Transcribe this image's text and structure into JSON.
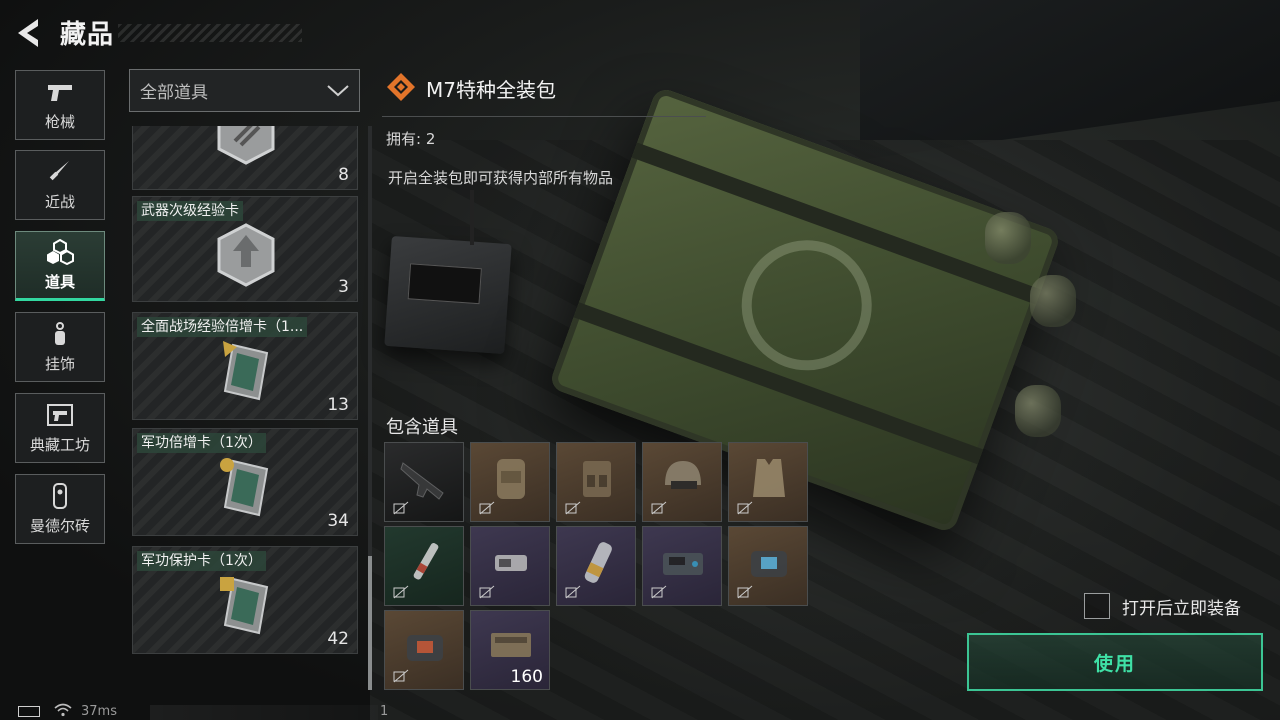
{
  "header": {
    "title": "藏品"
  },
  "categories": [
    {
      "label": "枪械",
      "icon": "pistol-icon"
    },
    {
      "label": "近战",
      "icon": "knife-icon"
    },
    {
      "label": "道具",
      "icon": "cubes-icon",
      "active": true
    },
    {
      "label": "挂饰",
      "icon": "charm-icon"
    },
    {
      "label": "典藏工坊",
      "icon": "workshop-icon"
    },
    {
      "label": "曼德尔砖",
      "icon": "brick-icon"
    }
  ],
  "filter": {
    "selected": "全部道具"
  },
  "items": [
    {
      "name": "",
      "count": "8"
    },
    {
      "name": "武器次级经验卡",
      "count": "3"
    },
    {
      "name": "全面战场经验倍增卡（1...",
      "count": "13"
    },
    {
      "name": "军功倍增卡（1次）",
      "count": "34"
    },
    {
      "name": "军功保护卡（1次）",
      "count": "42"
    }
  ],
  "detail": {
    "name": "M7特种全装包",
    "owned": "拥有: 2",
    "description": "开启全装包即可获得内部所有物品",
    "contains_title": "包含道具",
    "contents": [
      {
        "item": "rifle",
        "rarity": "black"
      },
      {
        "item": "backpack",
        "rarity": "brown"
      },
      {
        "item": "chest-rig",
        "rarity": "brown"
      },
      {
        "item": "helmet",
        "rarity": "brown"
      },
      {
        "item": "body-armor",
        "rarity": "brown"
      },
      {
        "item": "syringe",
        "rarity": "green"
      },
      {
        "item": "ammo-pack",
        "rarity": "purple"
      },
      {
        "item": "medicine-tube",
        "rarity": "purple"
      },
      {
        "item": "device",
        "rarity": "purple"
      },
      {
        "item": "med-bag",
        "rarity": "brown"
      },
      {
        "item": "trauma-kit",
        "rarity": "brown"
      },
      {
        "item": "ammo-box",
        "rarity": "purple",
        "qty": "160"
      }
    ]
  },
  "controls": {
    "auto_equip_label": "打开后立即装备",
    "auto_equip_checked": false,
    "use_button": "使用"
  },
  "status": {
    "ping": "37ms",
    "number": "1"
  },
  "colors": {
    "accent": "#3fe0a6",
    "rarity_black": "#1f2021",
    "rarity_brown": "#4d3e2f",
    "rarity_green": "#1c3027",
    "rarity_purple": "#342f45",
    "brand_orange": "#e2742a"
  }
}
